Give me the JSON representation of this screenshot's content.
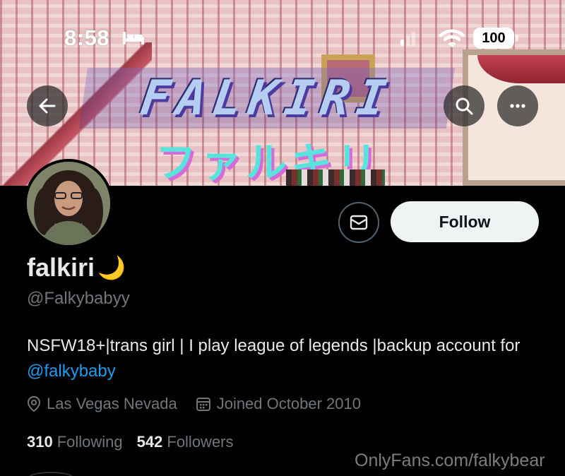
{
  "status_bar": {
    "time": "8:58",
    "battery": "100"
  },
  "banner": {
    "title_en": "FALKIRI",
    "title_jp": "ファルキリ"
  },
  "profile": {
    "display_name": "falkiri",
    "name_emoji": "🌙",
    "handle": "@Falkybabyy",
    "bio_text": "NSFW18+|trans girl | I play league of legends |backup account for ",
    "bio_mention": "@falkybaby",
    "location": "Las Vegas Nevada",
    "joined": "Joined October 2010",
    "following_count": "310",
    "following_label": "Following",
    "followers_count": "542",
    "followers_label": "Followers"
  },
  "actions": {
    "follow_label": "Follow"
  },
  "watermark": "OnlyFans.com/falkybear",
  "colors": {
    "background": "#000000",
    "text_primary": "#e7e9ea",
    "text_secondary": "#71767b",
    "link": "#1d9bf0",
    "follow_button_bg": "#eff3f4"
  },
  "icons": {
    "back": "arrow-left-icon",
    "search": "search-icon",
    "more": "more-horizontal-icon",
    "message": "envelope-icon",
    "location": "location-pin-icon",
    "calendar": "calendar-icon",
    "sleep_focus": "bed-icon",
    "signal": "cellular-signal-icon",
    "wifi": "wifi-icon"
  }
}
